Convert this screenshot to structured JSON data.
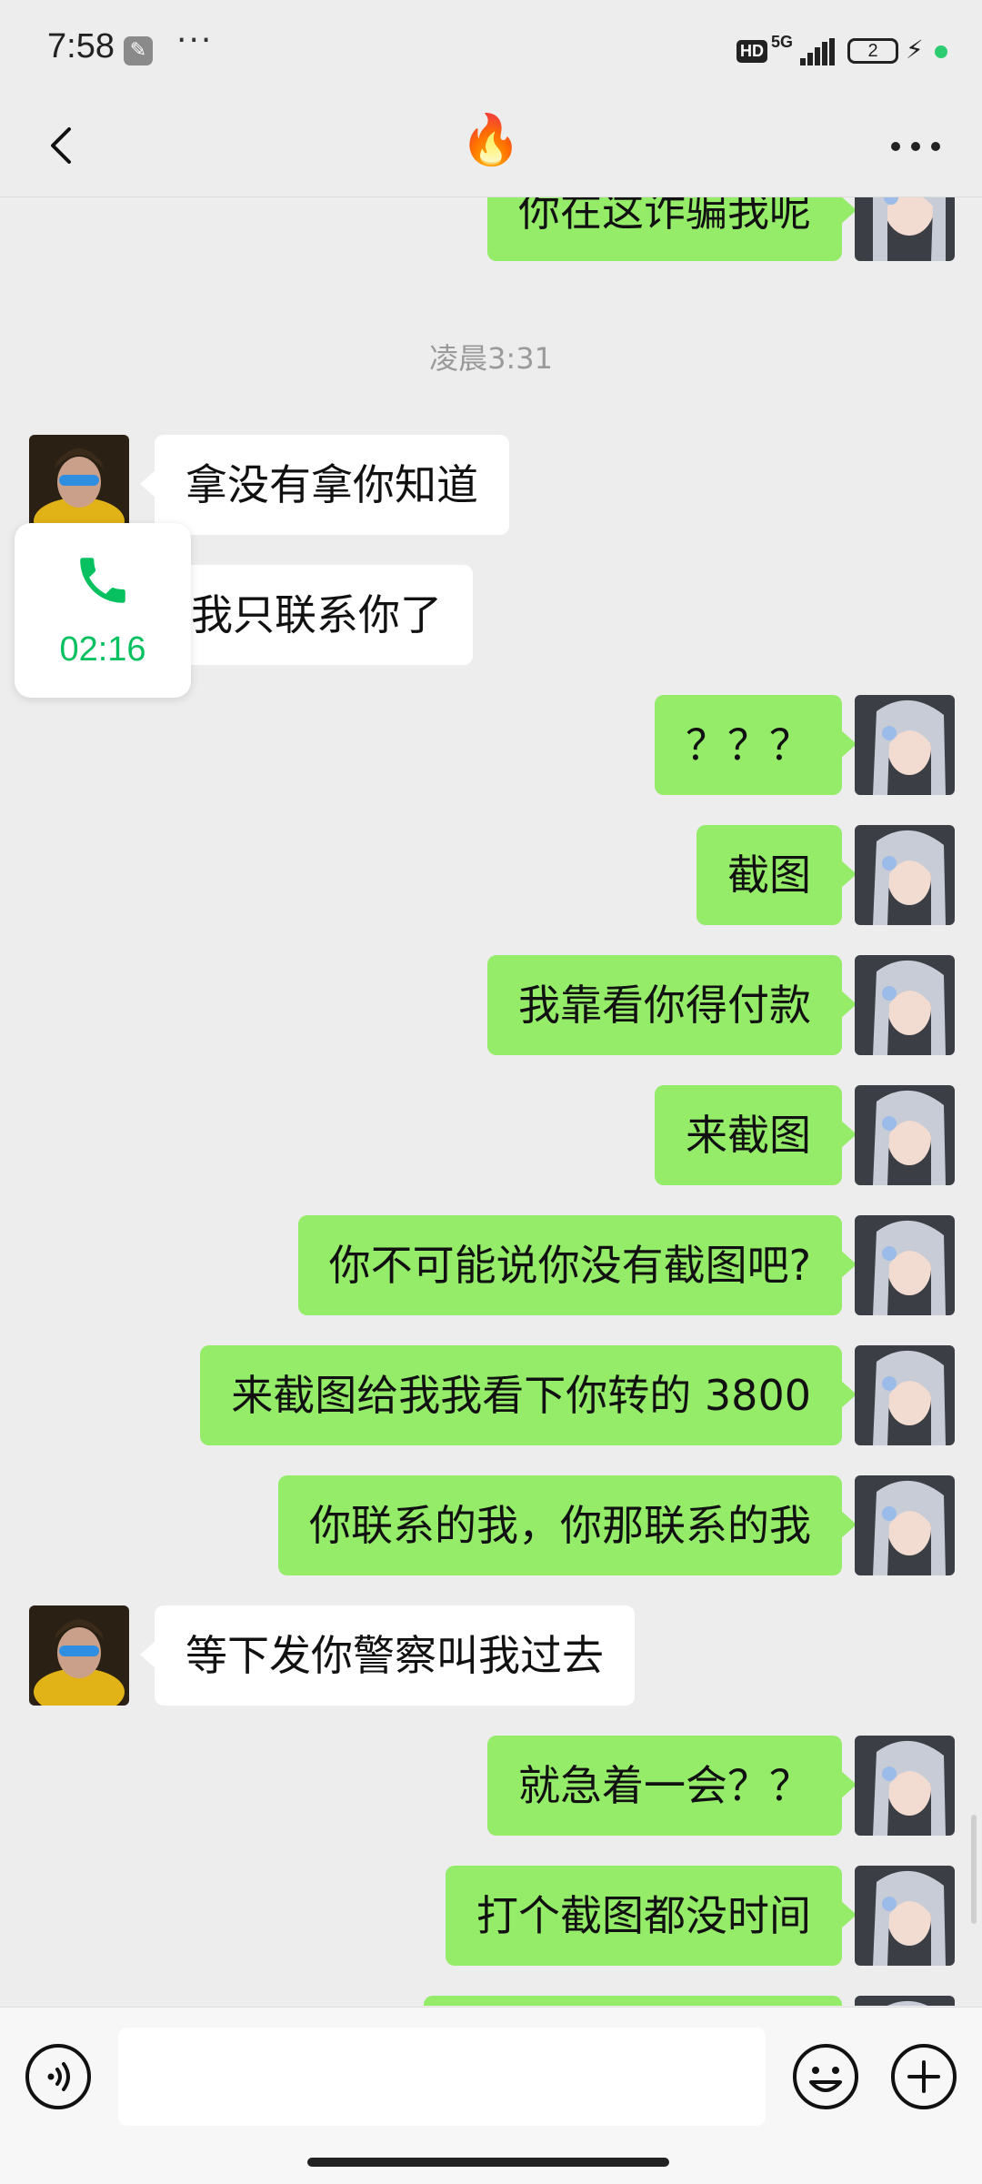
{
  "status_bar": {
    "time": "7:58",
    "wrench_icon": "wrench-icon",
    "more_dots": "···",
    "hd": "HD",
    "network": "5G",
    "battery": "2",
    "charging_icon": "⚡"
  },
  "header": {
    "title": "🔥",
    "back_icon": "chevron-left-icon",
    "more_icon": "more-dots-icon"
  },
  "messages": [
    {
      "side": "me",
      "text": "你在这诈骗我呢"
    },
    {
      "type": "timestamp",
      "text": "凌晨3:31"
    },
    {
      "side": "them",
      "text": "拿没有拿你知道"
    },
    {
      "side": "them",
      "text": "我只联系你了"
    },
    {
      "side": "me",
      "text": "？？？"
    },
    {
      "side": "me",
      "text": "截图"
    },
    {
      "side": "me",
      "text": "我靠看你得付款"
    },
    {
      "side": "me",
      "text": "来截图"
    },
    {
      "side": "me",
      "text": "你不可能说你没有截图吧?"
    },
    {
      "side": "me",
      "text": "来截图给我我看下你转的 3800"
    },
    {
      "side": "me",
      "text": "你联系的我，你那联系的我"
    },
    {
      "side": "them",
      "text": "等下发你警察叫我过去"
    },
    {
      "side": "me",
      "text": "就急着一会？？"
    },
    {
      "side": "me",
      "text": "打个截图都没时间"
    }
  ],
  "call_card": {
    "duration": "02:16",
    "icon": "phone-icon",
    "accent": "#07c160"
  },
  "input_bar": {
    "voice_icon": "voice-icon",
    "input_value": "",
    "emoji_icon": "emoji-icon",
    "plus_icon": "plus-icon"
  },
  "colors": {
    "my_bubble": "#95ec69",
    "their_bubble": "#ffffff",
    "background": "#ededed"
  }
}
